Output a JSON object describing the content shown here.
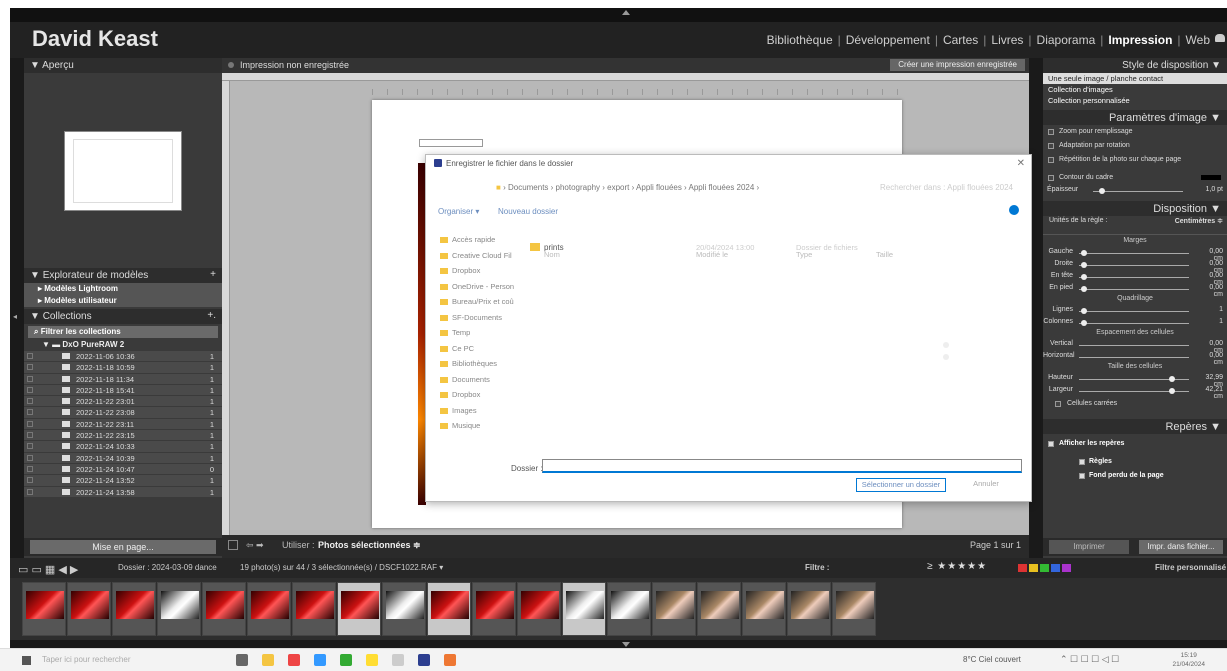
{
  "identity_plate": "David Keast",
  "modules": [
    "Bibliothèque",
    "Développement",
    "Cartes",
    "Livres",
    "Diaporama",
    "Impression",
    "Web"
  ],
  "active_module": "Impression",
  "left_panel": {
    "preview_header": "Aperçu",
    "templates_header": "Explorateur de modèles",
    "templates": [
      "Modèles Lightroom",
      "Modèles utilisateur"
    ],
    "collections_header": "Collections",
    "filter_label": "Filtrer les collections",
    "collection_set": "DxO PureRAW 2",
    "collections": [
      {
        "name": "2022-11-06 10:36",
        "count": "1"
      },
      {
        "name": "2022-11-18 10:59",
        "count": "1"
      },
      {
        "name": "2022-11-18 11:34",
        "count": "1"
      },
      {
        "name": "2022-11-18 15:41",
        "count": "1"
      },
      {
        "name": "2022-11-22 23:01",
        "count": "1"
      },
      {
        "name": "2022-11-22 23:08",
        "count": "1"
      },
      {
        "name": "2022-11-22 23:11",
        "count": "1"
      },
      {
        "name": "2022-11-22 23:15",
        "count": "1"
      },
      {
        "name": "2022-11-24 10:33",
        "count": "1"
      },
      {
        "name": "2022-11-24 10:39",
        "count": "1"
      },
      {
        "name": "2022-11-24 10:47",
        "count": "0"
      },
      {
        "name": "2022-11-24 13:52",
        "count": "1"
      },
      {
        "name": "2022-11-24 13:58",
        "count": "1"
      }
    ],
    "page_setup_button": "Mise en page..."
  },
  "center": {
    "title": "Impression non enregistrée",
    "create_button": "Créer une impression enregistrée",
    "use_label": "Utiliser :",
    "use_value": "Photos sélectionnées",
    "page_info": "Page 1 sur 1"
  },
  "dialog": {
    "title": "Enregistrer le fichier dans le dossier",
    "breadcrumb": "›  Documents  ›  photography  ›  export  ›  Appli flouées  ›  Appli flouées 2024  ›",
    "search_placeholder": "Rechercher dans : Appli flouées 2024",
    "organize": "Organiser ▾",
    "new_folder": "Nouveau dossier",
    "nav_items": [
      "Accès rapide",
      "Creative Cloud Fil",
      "Dropbox",
      "OneDrive - Person",
      "Bureau/Prix et coû",
      "SF-Documents",
      "Temp",
      "Ce PC",
      "Bibliothèques",
      "Documents",
      "Dropbox",
      "Images",
      "Musique"
    ],
    "columns": [
      "Nom",
      "Modifié le",
      "Type",
      "Taille"
    ],
    "file_name": "prints",
    "file_date": "20/04/2024 13:00",
    "file_type": "Dossier de fichiers",
    "folder_label": "Dossier :",
    "select_button": "Sélectionner un dossier",
    "cancel_button": "Annuler"
  },
  "right_panel": {
    "layout_style_header": "Style de disposition",
    "layout_styles": [
      "Une seule image / planche contact",
      "Collection d'images",
      "Collection personnalisée"
    ],
    "image_settings_header": "Paramètres d'image",
    "image_settings": [
      "Zoom pour remplissage",
      "Adaptation par rotation",
      "Répétition de la photo sur chaque page"
    ],
    "border_label": "Contour du cadre",
    "thickness_label": "Épaisseur",
    "thickness_value": "1,0 pt",
    "layout_header": "Disposition",
    "ruler_units_label": "Unités de la règle :",
    "ruler_units_value": "Centimètres ≑",
    "margins_title": "Marges",
    "margins": [
      {
        "label": "Gauche",
        "value": "0,00 cm"
      },
      {
        "label": "Droite",
        "value": "0,00 cm"
      },
      {
        "label": "En tête",
        "value": "0,00 cm"
      },
      {
        "label": "En pied",
        "value": "0,00 cm"
      }
    ],
    "grid_title": "Quadrillage",
    "grid": [
      {
        "label": "Lignes",
        "value": "1"
      },
      {
        "label": "Colonnes",
        "value": "1"
      }
    ],
    "spacing_title": "Espacement des cellules",
    "spacing": [
      {
        "label": "Vertical",
        "value": "0,00 cm"
      },
      {
        "label": "Horizontal",
        "value": "0,00 cm"
      }
    ],
    "cellsize_title": "Taille des cellules",
    "cellsize": [
      {
        "label": "Hauteur",
        "value": "32,99 cm"
      },
      {
        "label": "Largeur",
        "value": "42,21 cm"
      }
    ],
    "square_cells": "Cellules carrées",
    "guides_header": "Repères",
    "show_guides": "Afficher les repères",
    "rulers": "Règles",
    "bleed": "Fond perdu de la page",
    "print_button": "Imprimer",
    "print_to_file_button": "Impr. dans fichier..."
  },
  "filmstrip": {
    "source_label": "Dossier : 2024-03-09 dance",
    "selection_info": "19 photo(s) sur 44 / 3 sélectionnée(s) / DSCF1022.RAF ▾",
    "filter_label": "Filtre :",
    "filter_value": "Filtre personnalisé",
    "stars": "≥ ★★★★★",
    "colors": [
      "#d33",
      "#e8c020",
      "#3b3",
      "#36d",
      "#a3c"
    ],
    "thumbs": [
      "r",
      "r",
      "r",
      "w",
      "r",
      "r",
      "r",
      "r",
      "w",
      "r",
      "r",
      "r",
      "w",
      "w",
      "t",
      "t",
      "t",
      "t",
      "t"
    ]
  },
  "taskbar": {
    "search_placeholder": "Taper ici pour rechercher",
    "weather": "8°C  Ciel couvert",
    "time": "15:19",
    "date": "21/04/2024"
  }
}
